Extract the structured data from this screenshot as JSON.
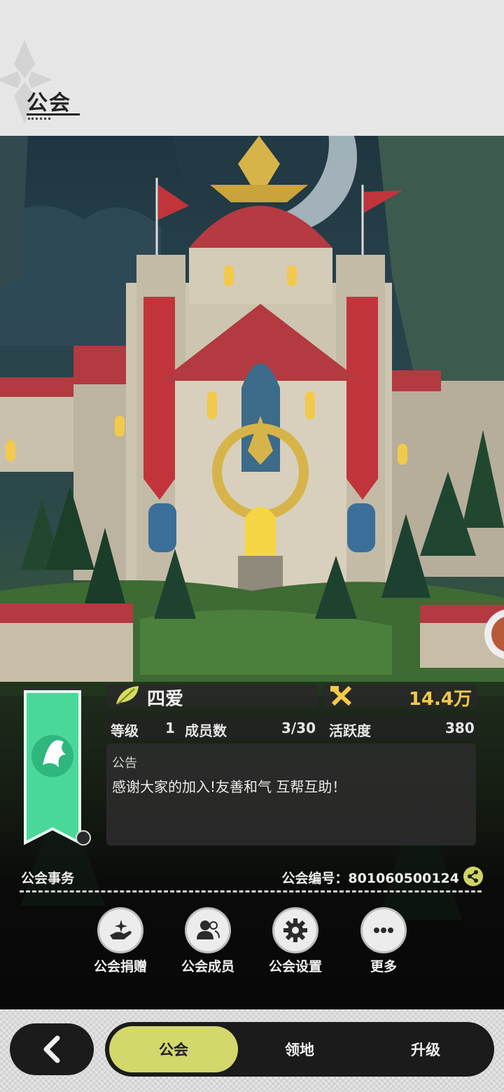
{
  "header": {
    "title": "公会"
  },
  "guild": {
    "name": "四爱",
    "power": "14.4万",
    "stats": {
      "level_label": "等级",
      "level_value": "1",
      "members_label": "成员数",
      "members_value": "3/30",
      "activity_label": "活跃度",
      "activity_value": "380"
    },
    "notice_label": "公告",
    "notice_text": "感谢大家的加入!友善和气 互帮互助！"
  },
  "affairs": {
    "label": "公会事务",
    "guild_id_text": "公会编号：801060500124"
  },
  "actions": [
    {
      "label": "公会捐赠",
      "icon": "donate-icon"
    },
    {
      "label": "公会成员",
      "icon": "members-icon"
    },
    {
      "label": "公会设置",
      "icon": "gear-icon"
    },
    {
      "label": "更多",
      "icon": "more-icon"
    }
  ],
  "tabs": [
    {
      "label": "公会",
      "active": true
    },
    {
      "label": "领地",
      "active": false
    },
    {
      "label": "升级",
      "active": false
    }
  ],
  "colors": {
    "accent": "#d3d86c",
    "power": "#f4c94a",
    "banner": "#49d89a"
  }
}
